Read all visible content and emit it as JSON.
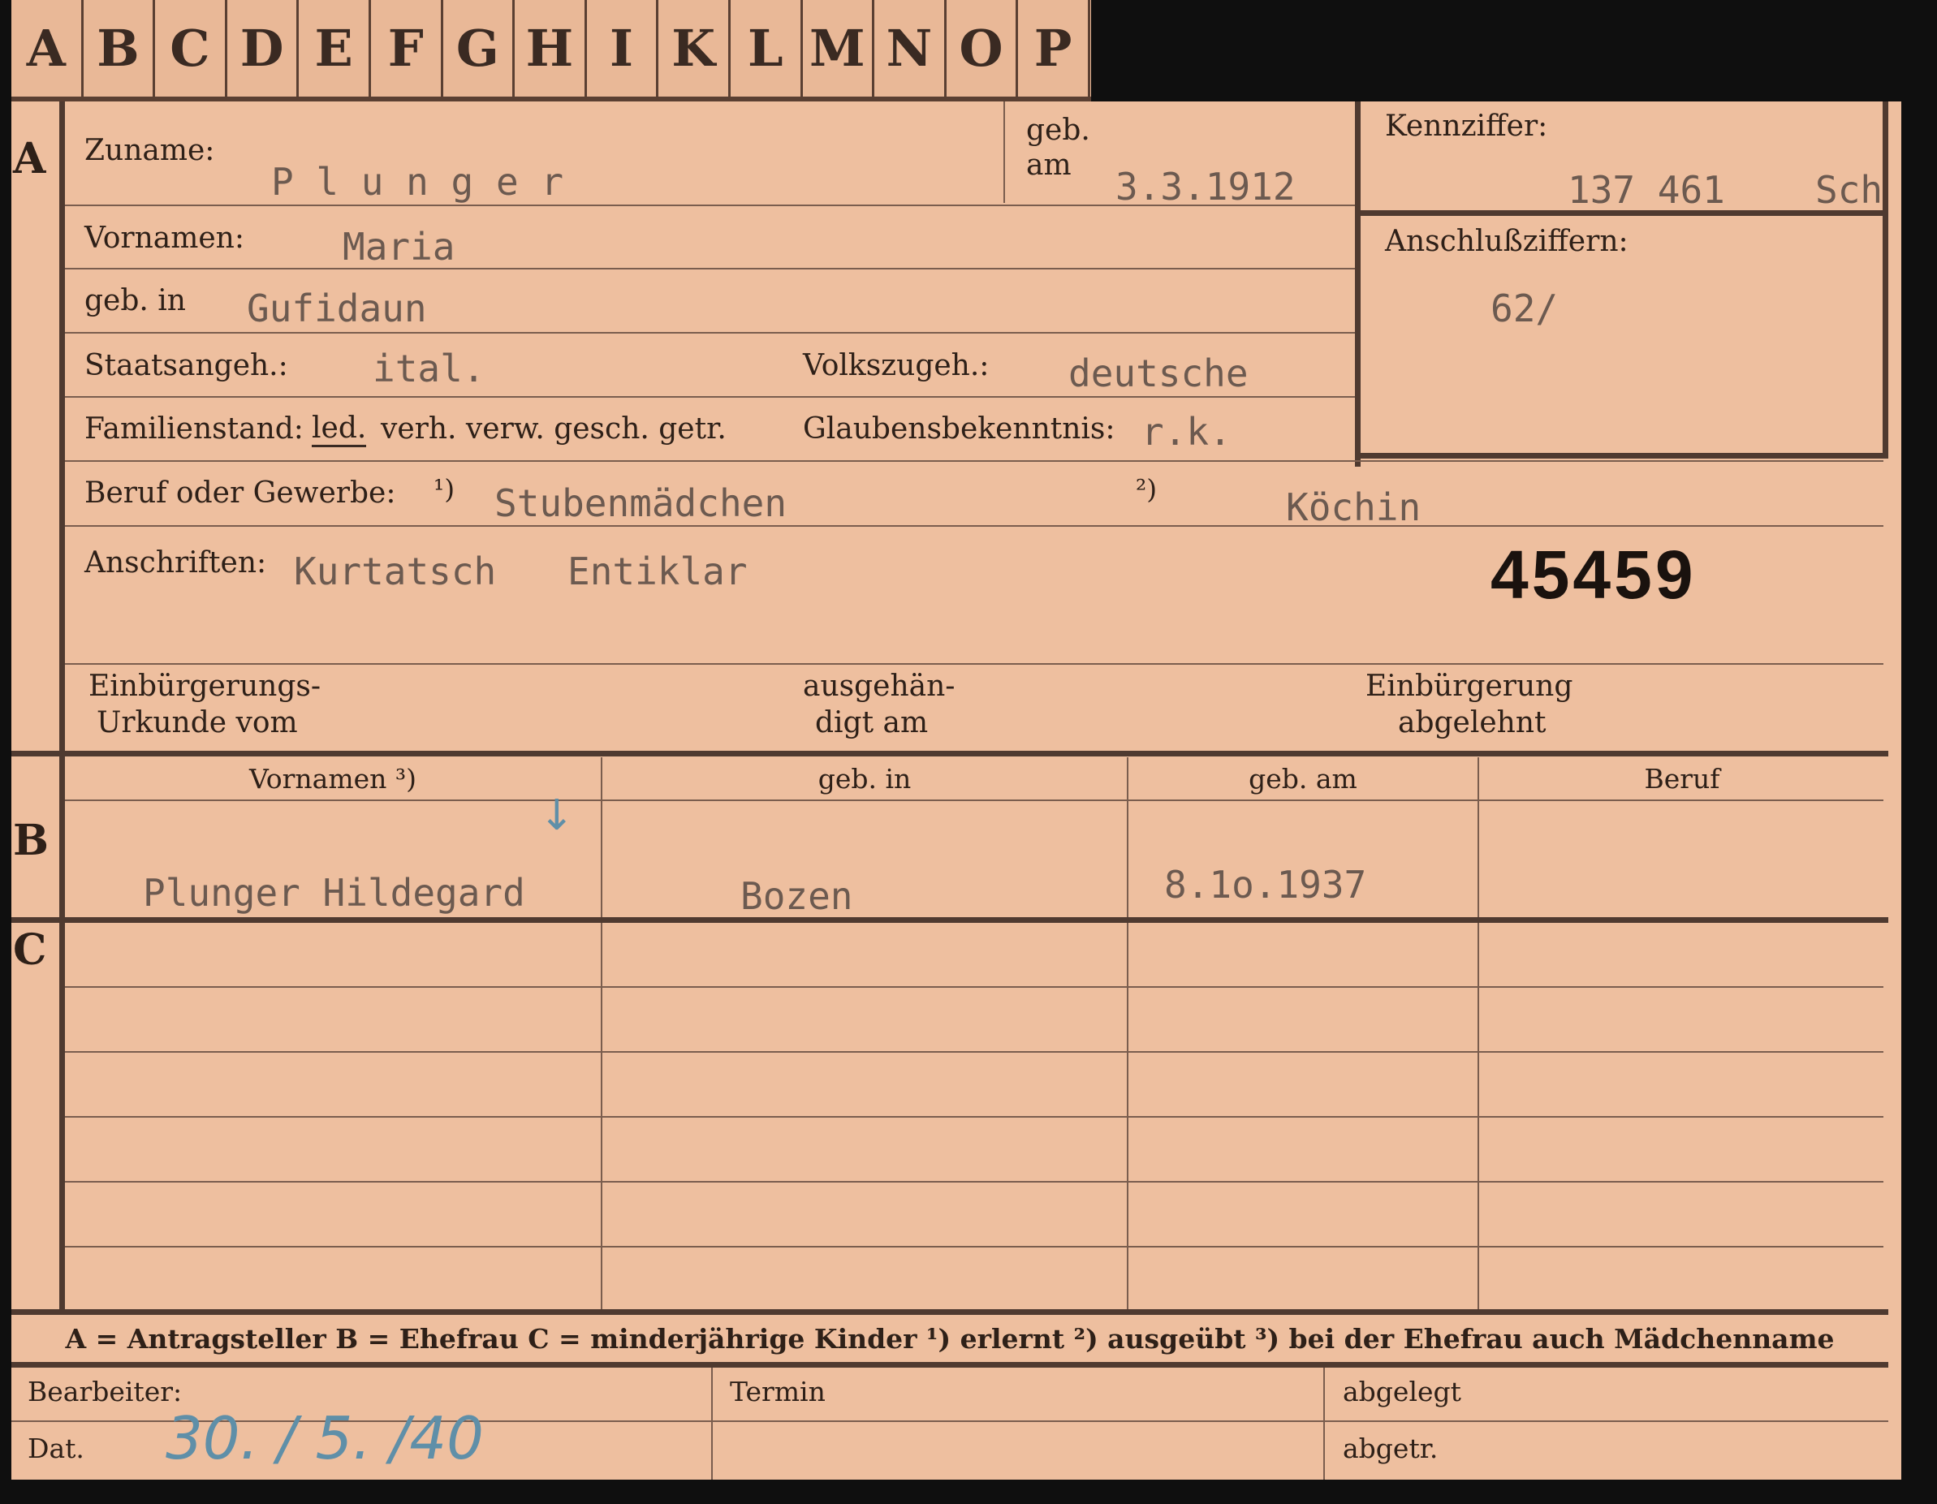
{
  "tabs": [
    "A",
    "B",
    "C",
    "D",
    "E",
    "F",
    "G",
    "H",
    "I",
    "K",
    "L",
    "M",
    "N",
    "O",
    "P"
  ],
  "sections": {
    "a": "A",
    "b": "B",
    "c": "C"
  },
  "section_a": {
    "zuname_label": "Zuname:",
    "zuname_value": "P l u n g e r",
    "geb_am_label_1": "geb.",
    "geb_am_label_2": "am",
    "geb_am_value": "3.3.1912",
    "kennziffer_label": "Kennziffer:",
    "kennziffer_value": "137 461",
    "kennziffer_suffix": "Sch",
    "anschluss_label": "Anschlußziffern:",
    "anschluss_value": "62/",
    "vornamen_label": "Vornamen:",
    "vornamen_value": "Maria",
    "geb_in_label": "geb. in",
    "geb_in_value": "Gufidaun",
    "staatsangeh_label": "Staatsangeh.:",
    "staatsangeh_value": "ital.",
    "volkszugeh_label": "Volkszugeh.:",
    "volkszugeh_value": "deutsche",
    "familienstand_label": "Familienstand:",
    "familienstand_led": "led.",
    "familienstand_rest": "verh. verw. gesch. getr.",
    "glaubens_label": "Glaubensbekenntnis:",
    "glaubens_value": "r.k.",
    "beruf_label": "Beruf oder Gewerbe:",
    "beruf_note1": "¹)",
    "beruf_value1": "Stubenmädchen",
    "beruf_note2": "²)",
    "beruf_value2": "Köchin",
    "anschriften_label": "Anschriften:",
    "anschriften_value1": "Kurtatsch",
    "anschriften_value2": "Entiklar",
    "stamp_number": "45459",
    "einb_urkunde_1": "Einbürgerungs-",
    "einb_urkunde_2": "Urkunde vom",
    "ausgehaendigt_1": "ausgehän-",
    "ausgehaendigt_2": "digt am",
    "einb_abgelehnt_1": "Einbürgerung",
    "einb_abgelehnt_2": "abgelehnt"
  },
  "table": {
    "headers": [
      "Vornamen ³)",
      "geb. in",
      "geb. am",
      "Beruf"
    ],
    "row_b": {
      "vornamen": "Plunger  Hildegard",
      "geb_in": "Bozen",
      "geb_am": "8.1o.1937",
      "beruf": ""
    }
  },
  "legend": {
    "text": "A = Antragsteller   B = Ehefrau   C = minderjährige Kinder   ¹) erlernt   ²) ausgeübt   ³) bei der Ehefrau auch Mädchenname"
  },
  "footer": {
    "bearbeiter_label": "Bearbeiter:",
    "dat_label": "Dat.",
    "dat_value": "30. / 5. /40",
    "termin_label": "Termin",
    "abgelegt_label": "abgelegt",
    "abgetr_label": "abgetr."
  },
  "colors": {
    "card": "#eebf9f",
    "ink": "#2e2018",
    "typed": "#6c5a50",
    "pencil": "#5f8fa8"
  }
}
